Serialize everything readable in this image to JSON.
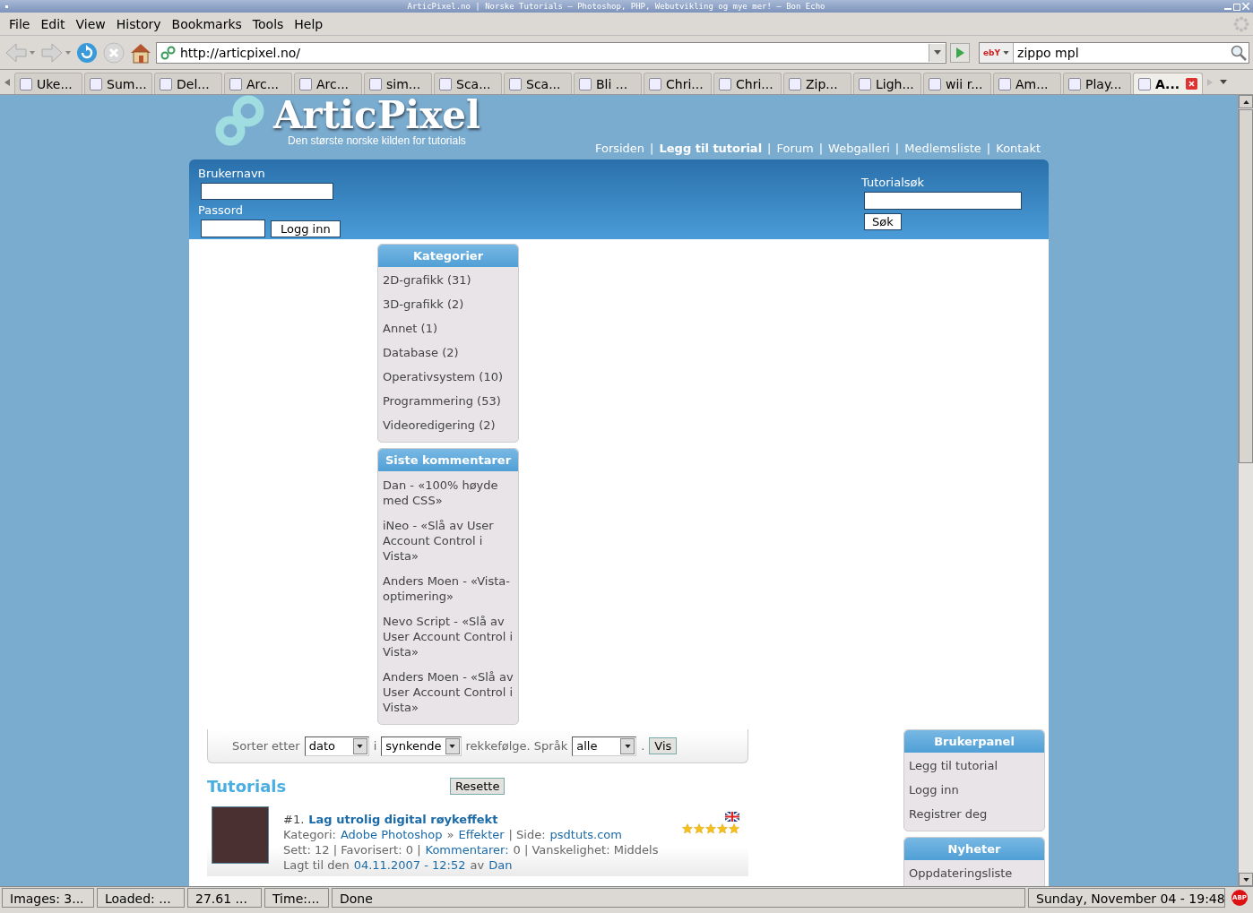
{
  "window": {
    "title": "ArticPixel.no | Norske Tutorials – Photoshop, PHP, Webutvikling og mye mer! – Bon Echo"
  },
  "menu": [
    "File",
    "Edit",
    "View",
    "History",
    "Bookmarks",
    "Tools",
    "Help"
  ],
  "toolbar": {
    "url": "http://articpixel.no/",
    "search_engine": "ebY",
    "search": "zippo mpl"
  },
  "tabs": [
    {
      "label": "Uke...",
      "selected": false
    },
    {
      "label": "Sum...",
      "selected": false
    },
    {
      "label": "Del...",
      "selected": false
    },
    {
      "label": "Arc...",
      "selected": false
    },
    {
      "label": "Arc...",
      "selected": false
    },
    {
      "label": "sim...",
      "selected": false
    },
    {
      "label": "Sca...",
      "selected": false
    },
    {
      "label": "Sca...",
      "selected": false
    },
    {
      "label": "Bli ...",
      "selected": false
    },
    {
      "label": "Chri...",
      "selected": false
    },
    {
      "label": "Chri...",
      "selected": false
    },
    {
      "label": "Zip...",
      "selected": false
    },
    {
      "label": "Ligh...",
      "selected": false
    },
    {
      "label": "wii r...",
      "selected": false
    },
    {
      "label": "Am...",
      "selected": false
    },
    {
      "label": "Play...",
      "selected": false
    },
    {
      "label": "A...",
      "selected": true
    }
  ],
  "site": {
    "logo": "ArticPixel",
    "tagline": "Den største norske kilden for tutorials",
    "separator": "|",
    "nav": [
      {
        "label": "Forsiden",
        "bold": false
      },
      {
        "label": "Legg til tutorial",
        "bold": true
      },
      {
        "label": "Forum",
        "bold": false
      },
      {
        "label": "Webgalleri",
        "bold": false
      },
      {
        "label": "Medlemsliste",
        "bold": false
      },
      {
        "label": "Kontakt",
        "bold": false
      }
    ]
  },
  "login": {
    "username_label": "Brukernavn",
    "password_label": "Passord",
    "button": "Logg inn"
  },
  "search": {
    "label": "Tutorialsøk",
    "button": "Søk"
  },
  "categories": {
    "title": "Kategorier",
    "items": [
      "2D-grafikk (31)",
      "3D-grafikk (2)",
      "Annet (1)",
      "Database (2)",
      "Operativsystem (10)",
      "Programmering (53)",
      "Videoredigering (2)"
    ]
  },
  "comments": {
    "title": "Siste kommentarer",
    "items": [
      "Dan - «100% høyde med CSS»",
      "iNeo - «Slå av User Account Control i Vista»",
      "Anders Moen - «Vista-optimering»",
      "Nevo Script - «Slå av User Account Control i Vista»",
      "Anders Moen - «Slå av User Account Control i Vista»"
    ]
  },
  "sort": [
    {
      "kind": "text",
      "text": "Sorter etter"
    },
    {
      "kind": "select",
      "text": "dato"
    },
    {
      "kind": "text",
      "text": "i"
    },
    {
      "kind": "select",
      "text": "synkende"
    },
    {
      "kind": "text",
      "text": "rekkefølge. Språk"
    },
    {
      "kind": "select",
      "text": "alle"
    },
    {
      "kind": "text",
      "text": "."
    },
    {
      "kind": "button",
      "text": "Vis"
    }
  ],
  "tutorials_heading": "Tutorials",
  "reset_button": "Resette",
  "tutorials": [
    {
      "number": "#1.",
      "title": "Lag utrolig digital røykeffekt",
      "stars": 5,
      "lines": [
        [
          {
            "text": "Kategori:",
            "link": false
          },
          {
            "text": "Adobe Photoshop",
            "link": true
          },
          {
            "text": "»",
            "link": false
          },
          {
            "text": "Effekter",
            "link": true
          },
          {
            "text": "| Side:",
            "link": false
          },
          {
            "text": "psdtuts.com",
            "link": true
          }
        ],
        [
          {
            "text": "Sett: 12 | Favorisert: 0 |",
            "link": false
          },
          {
            "text": "Kommentarer:",
            "link": true
          },
          {
            "text": "0 | Vanskelighet: Middels",
            "link": false
          }
        ],
        [
          {
            "text": "Lagt til den",
            "link": false
          },
          {
            "text": "04.11.2007 - 12:52",
            "link": true
          },
          {
            "text": "av",
            "link": false
          },
          {
            "text": "Dan",
            "link": true
          }
        ]
      ]
    }
  ],
  "user_panel": {
    "title": "Brukerpanel",
    "items": [
      "Legg til tutorial",
      "Logg inn",
      "Registrer deg"
    ]
  },
  "news": {
    "title": "Nyheter",
    "items": [
      "Oppdateringsliste"
    ]
  },
  "status_bar": [
    "Images: 3...",
    "Loaded: ...",
    "27.61 ...",
    "Time:...",
    "Done",
    "Sunday, November 04 - 19:48"
  ],
  "adblock": "ABP"
}
